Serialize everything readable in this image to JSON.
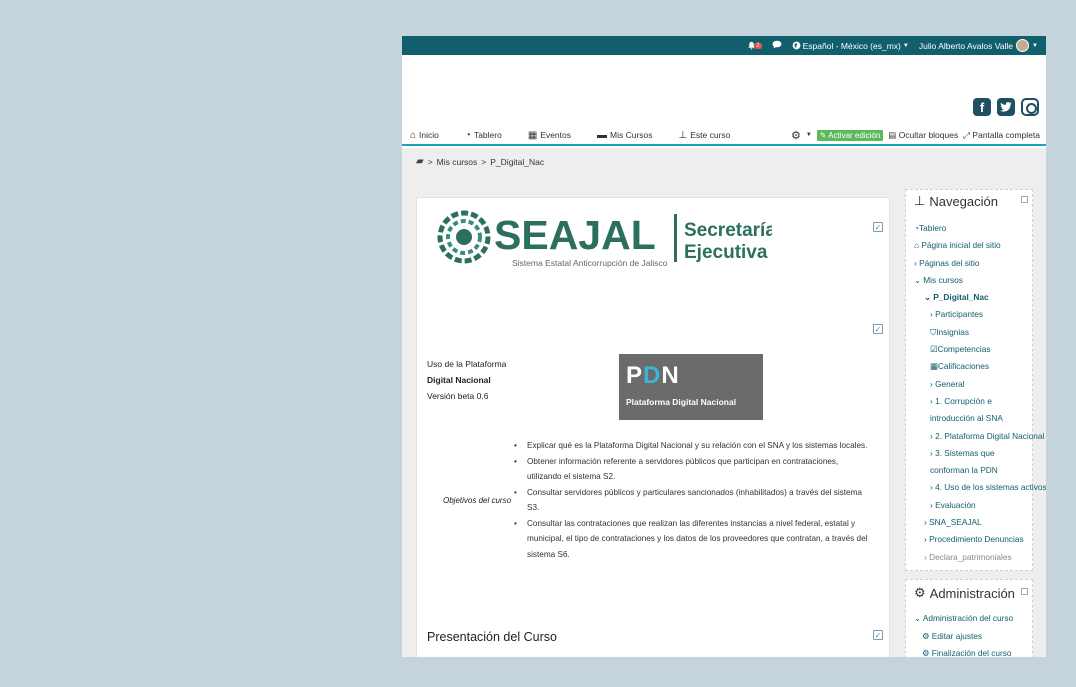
{
  "topbar": {
    "notification_count": "2",
    "language": "Español - México (es_mx)",
    "user_name": "Julio Alberto Avalos Valle"
  },
  "navbar": {
    "items": [
      {
        "label": "Inicio",
        "icon": "home-icon"
      },
      {
        "label": "Tablero",
        "icon": "dashboard-icon"
      },
      {
        "label": "Eventos",
        "icon": "calendar-icon"
      },
      {
        "label": "Mis Cursos",
        "icon": "briefcase-icon"
      },
      {
        "label": "Este curso",
        "icon": "sitemap-icon"
      }
    ],
    "activate_edit": "Activar edición",
    "hide_blocks": "Ocultar bloques",
    "fullscreen": "Pantalla completa"
  },
  "breadcrumb": {
    "sep": ">",
    "mis_cursos": "Mis cursos",
    "course": "P_Digital_Nac"
  },
  "main": {
    "logo": {
      "name": "SEAJAL",
      "tagline": "Sistema Estatal Anticorrupción de Jalisco",
      "line1": "Secretaría",
      "line2": "Ejecutiva"
    },
    "uso_line1": "Uso de la Plataforma",
    "uso_line2": "Digital  Nacional",
    "uso_line3": "Versión beta 0.6",
    "pdn_p": "P",
    "pdn_d": "D",
    "pdn_n": "N",
    "pdn_caption": "Plataforma Digital Nacional",
    "objectives_label": "Objetivos del curso",
    "objectives": [
      "Explicar qué es la Plataforma  Digital  Nacional y su relación con el SNA y los sistemas locales.",
      "Obtener información referente a servidores públicos que participan en contrataciones, utilizando el sistema S2.",
      "Consultar servidores públicos y particulares sancionados (inhabilitados) a través del sistema S3.",
      "Consultar las contrataciones que realizan las diferentes instancias a nivel federal, estatal y municipal, el tipo de contrataciones y los datos de los proveedores que contratan, a través del sistema S6."
    ],
    "presentation_title": "Presentación del Curso"
  },
  "navigation": {
    "title": "Navegación",
    "items": [
      "Tablero",
      "Página inicial del sitio",
      "Páginas del sitio",
      "Mis cursos",
      "P_Digital_Nac",
      "Participantes",
      "Insignias",
      "Competencias",
      "Calificaciones",
      "General",
      "1. Corrupción e introducción al SNA",
      "2. Plataforma Digital Nacional",
      "3. Sistemas que conforman la PDN",
      "4. Uso de los sistemas activos",
      "Evaluación",
      "SNA_SEAJAL",
      "Procedimiento Denuncias",
      "Declara_patrimoniales"
    ]
  },
  "administration": {
    "title": "Administración",
    "items": [
      "Administración del curso",
      "Editar ajustes",
      "Finalización del curso"
    ]
  },
  "colors": {
    "topbar": "#115e6d",
    "accent": "#1aa3b9",
    "logo_green": "#2d6f5f",
    "edit_button": "#5cb85c"
  }
}
